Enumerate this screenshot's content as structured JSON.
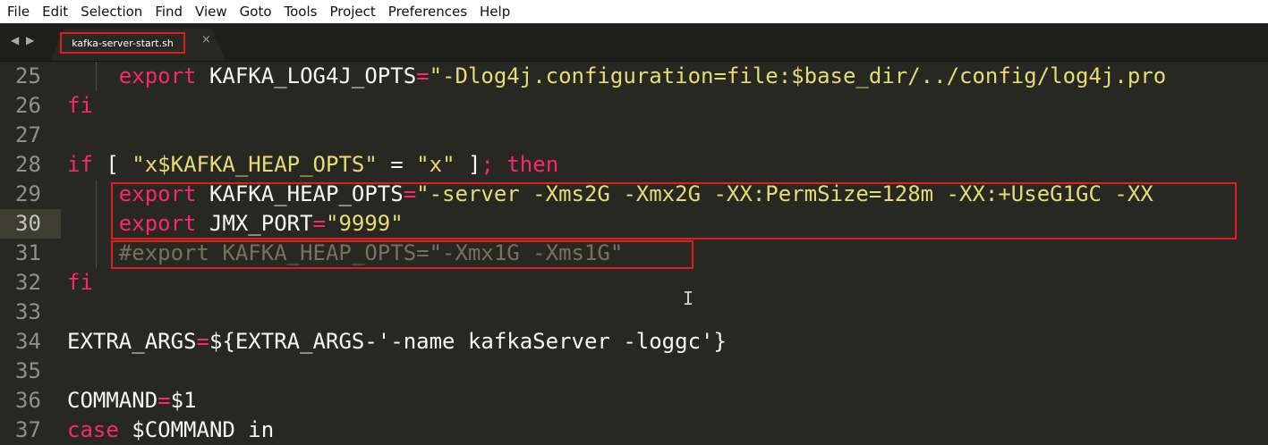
{
  "menu": {
    "items": [
      "File",
      "Edit",
      "Selection",
      "Find",
      "View",
      "Goto",
      "Tools",
      "Project",
      "Preferences",
      "Help"
    ]
  },
  "tab": {
    "title": "kafka-server-start.sh",
    "close_glyph": "×",
    "nav_glyph": "◀ ▶"
  },
  "editor": {
    "active_line": "30",
    "lines": [
      {
        "num": "25",
        "tokens": [
          [
            "    ",
            "plain"
          ],
          [
            "export",
            "kw"
          ],
          [
            " KAFKA_LOG4J_OPTS",
            "plain"
          ],
          [
            "=",
            "kw"
          ],
          [
            "\"-Dlog4j.configuration=file:$base_dir/../config/log4j.pro",
            "str"
          ]
        ]
      },
      {
        "num": "26",
        "tokens": [
          [
            "fi",
            "kw"
          ]
        ]
      },
      {
        "num": "27",
        "tokens": []
      },
      {
        "num": "28",
        "tokens": [
          [
            "if",
            "kw"
          ],
          [
            " [ ",
            "plain"
          ],
          [
            "\"x$KAFKA_HEAP_OPTS\"",
            "str"
          ],
          [
            " = ",
            "plain"
          ],
          [
            "\"x\"",
            "str"
          ],
          [
            " ]",
            "plain"
          ],
          [
            "; ",
            "kw"
          ],
          [
            "then",
            "kw"
          ]
        ]
      },
      {
        "num": "29",
        "tokens": [
          [
            "    ",
            "plain"
          ],
          [
            "export",
            "kw"
          ],
          [
            " KAFKA_HEAP_OPTS",
            "plain"
          ],
          [
            "=",
            "kw"
          ],
          [
            "\"-server -Xms2G -Xmx2G -XX:PermSize=128m -XX:+UseG1GC -XX",
            "str"
          ]
        ]
      },
      {
        "num": "30",
        "tokens": [
          [
            "    ",
            "plain"
          ],
          [
            "export",
            "kw"
          ],
          [
            " JMX_PORT",
            "plain"
          ],
          [
            "=",
            "kw"
          ],
          [
            "\"9999\"",
            "str"
          ]
        ]
      },
      {
        "num": "31",
        "tokens": [
          [
            "    ",
            "plain"
          ],
          [
            "#export KAFKA_HEAP_OPTS=\"-Xmx1G -Xms1G\"",
            "cmt"
          ]
        ]
      },
      {
        "num": "32",
        "tokens": [
          [
            "fi",
            "kw"
          ]
        ]
      },
      {
        "num": "33",
        "tokens": []
      },
      {
        "num": "34",
        "tokens": [
          [
            "EXTRA_ARGS",
            "plain"
          ],
          [
            "=",
            "kw"
          ],
          [
            "${EXTRA_ARGS-'-name kafkaServer -loggc'}",
            "plain"
          ]
        ]
      },
      {
        "num": "35",
        "tokens": []
      },
      {
        "num": "36",
        "tokens": [
          [
            "COMMAND",
            "plain"
          ],
          [
            "=",
            "kw"
          ],
          [
            "$1",
            "plain"
          ]
        ]
      },
      {
        "num": "37",
        "tokens": [
          [
            "case",
            "kw"
          ],
          [
            " $COMMAND in",
            "plain"
          ]
        ]
      }
    ]
  },
  "colors": {
    "background": "#272822",
    "keyword": "#f92672",
    "string": "#e6db74",
    "comment": "#75715e",
    "highlight_box": "#e21b1b"
  }
}
